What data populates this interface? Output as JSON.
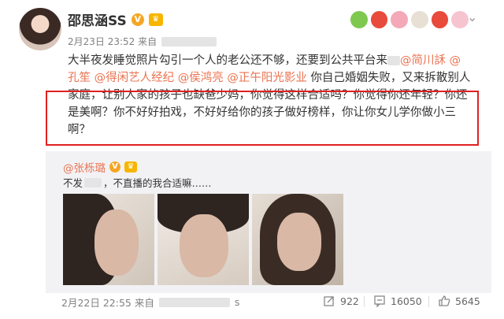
{
  "post": {
    "username": "邵思涵SS",
    "v_badge": "V",
    "crown_badge": "♛",
    "timestamp": "2月23日 23:52 来自",
    "text_lines": [
      [
        "大半夜发睡觉照片勾引一个人的老公还不够，还要到公共平台来"
      ],
      [
        "孔笙 ",
        "@得闲艺人经纪",
        " ",
        "@侯鸿亮",
        " ",
        "@正午阳光影业",
        " 你自己婚姻失败，又来拆散别人"
      ],
      [
        "家庭，让别人家的孩子也缺爸少妈，你觉得这样合适吗？你觉得你还年轻？你还"
      ],
      [
        "是美啊？你不好好拍戏，不好好给你的孩子做好榜样，你让你女儿学你做小三"
      ],
      [
        "啊？"
      ]
    ],
    "line1_mentions": [
      "@简川訸",
      " @"
    ]
  },
  "repost": {
    "author": "@张栎璐",
    "v_badge": "V",
    "text_before": "不发",
    "text_after": "，不直播的我合适嘛……"
  },
  "footer": {
    "date": "2月22日 22:55 来自",
    "source_tail": "s",
    "reposts": "922",
    "comments": "16050",
    "likes": "5645"
  },
  "colors": {
    "accent": "#eb7350",
    "highlight_box": "#e02020",
    "repost_bg": "#f2f2f5"
  },
  "icons": [
    "chevron-down-icon",
    "repost-icon",
    "comment-icon",
    "like-icon"
  ]
}
